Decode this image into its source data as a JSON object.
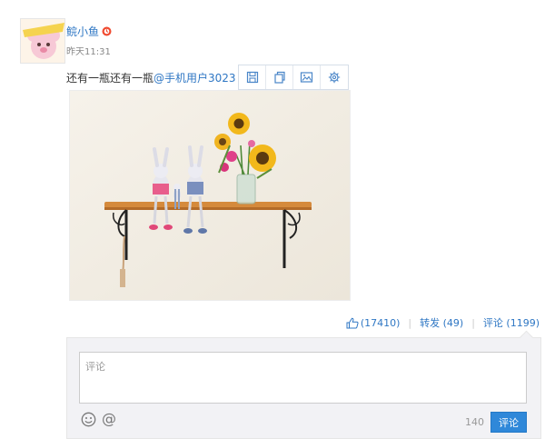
{
  "post": {
    "author": "鲩小鱼",
    "time": "昨天11:31",
    "text_prefix": "还有一瓶还有一瓶",
    "mention": "@手机用户3023"
  },
  "image_toolbar": {
    "icons": [
      "save-icon",
      "copy-icon",
      "picture-icon",
      "settings-icon"
    ]
  },
  "actions": {
    "like_count": "(17410)",
    "repost_label": "转发 (49)",
    "comment_label": "评论 (1199)"
  },
  "comment": {
    "placeholder": "评论",
    "char_count": "140",
    "submit_label": "评论"
  },
  "colors": {
    "link": "#2f77c4",
    "button": "#2f88d9"
  }
}
